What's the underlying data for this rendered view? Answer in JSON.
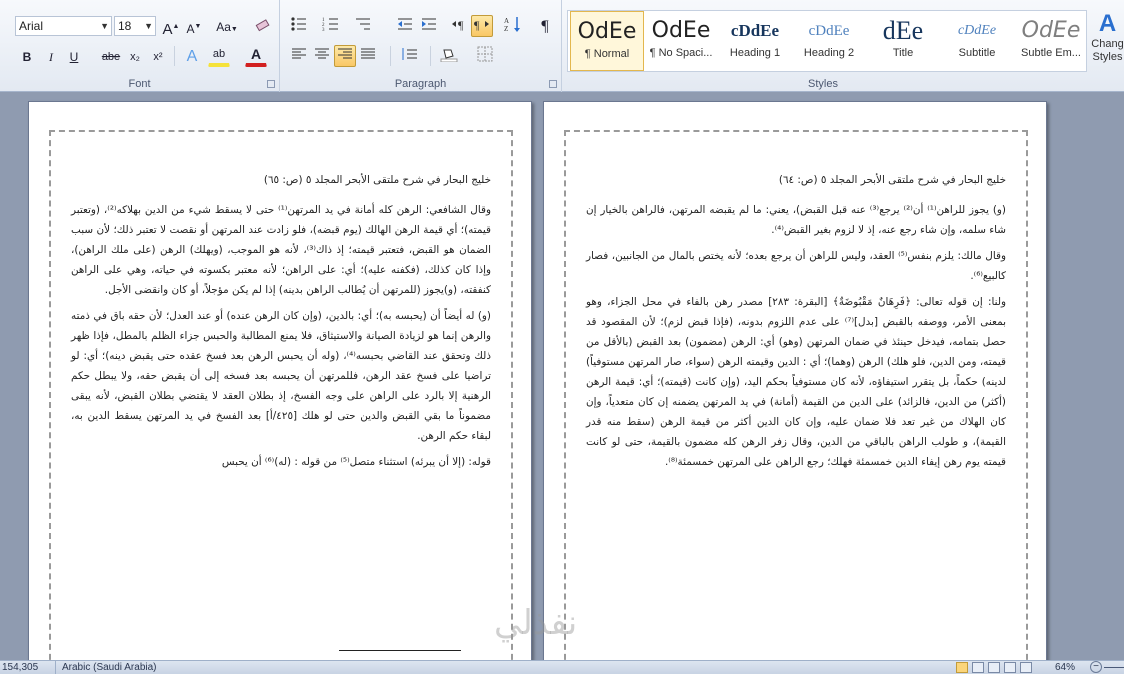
{
  "ribbon": {
    "font": {
      "group_label": "Font",
      "font_name": "Arial",
      "font_size": "18",
      "grow": "A",
      "shrink": "A",
      "change_case": "Aa",
      "bold": "B",
      "italic": "I",
      "underline": "U",
      "strike": "abe",
      "subscript": "x₂",
      "superscript": "x²",
      "text_effects": "A",
      "highlight": "ab",
      "font_color": "A"
    },
    "paragraph": {
      "group_label": "Paragraph"
    },
    "styles": {
      "group_label": "Styles",
      "items": [
        {
          "sample": "OdEe",
          "name": "¶ Normal"
        },
        {
          "sample": "OdEe",
          "name": "¶ No Spaci..."
        },
        {
          "sample": "cDdEe",
          "name": "Heading 1"
        },
        {
          "sample": "cDdEe",
          "name": "Heading 2"
        },
        {
          "sample": "dEe",
          "name": "Title"
        },
        {
          "sample": "cDdEe",
          "name": "Subtitle"
        },
        {
          "sample": "OdEe",
          "name": "Subtle Em..."
        }
      ],
      "change_styles_line1": "Chang",
      "change_styles_line2": "Styles"
    },
    "colors": {
      "highlight": "#f5e23a",
      "font_color": "#d22020",
      "accent": "#2a6fcf"
    }
  },
  "left_page": {
    "header": "خليج البحار في شرح ملتقى الأبحر المجلد ٥ (ص: ٦٥)",
    "paragraphs": [
      "وقال الشافعي: الرهن كله أمانة في يد المرتهن⁽¹⁾ حتى لا يسقط شيء من الدين بهلاكه⁽²⁾، (وتعتبر قيمته)؛ أي قيمة الرهن الهالك (يوم قبضه)، فلو زادت عند المرتهن أو نقصت لا تعتبر ذلك؛ لأن سبب الضمان هو القبض، فتعتبر قيمته؛ إذ ذاك⁽³⁾، لأنه هو الموجب، (ويهلك) الرهن (على ملك الراهن)، وإذا كان كذلك، (فكفنه عليه)؛ أي: على الراهن؛ لأنه معتبر بكسوته في حياته، وهي على الراهن كنفقته، (و)يجوز (للمرتهن أن يُطالب الراهن بدينه) إذا لم يكن مؤجلاً، أو كان وانقضى الأجل.",
      "(و) له أيضاً أن (يحبسه به)؛ أي: بالدين، (وإن كان الرهن عنده) أو عند العدل؛ لأن حقه باق في ذمته والرهن إنما هو لزيادة الصيانة والاستيثاق، فلا يمنع المطالبة والحبس جزاء الظلم بالمطل، فإذا ظهر ذلك وتحقق عند القاضي بحبسه⁽⁴⁾، (وله أن يحبس الرهن بعد فسخ عقده حتى يقبض دينه)؛ أي: لو تراضيا على فسخ عقد الرهن، فللمرتهن أن يحبسه بعد فسخه إلى أن يقبض حقه، ولا يبطل حكم الرهنية إلا بالرد على الراهن على وجه الفسخ، إذ بطلان العقد لا يقتضي بطلان القبض، لأنه يبقى مضموناً ما بقي القبض والدين حتى لو هلك [٤٢٥/أ] بعد الفسخ في يد المرتهن يسقط الدين به، لبقاء حكم الرهن.",
      "قوله: (إلا أن يبرئه) استثناء متصل⁽⁵⁾ من قوله : (له)⁽⁶⁾ أن يحبس"
    ]
  },
  "right_page": {
    "header": "خليج البحار في شرح ملتقى الأبحر المجلد ٥ (ص: ٦٤)",
    "paragraphs": [
      "(و) يجوز للراهن⁽¹⁾ أن⁽²⁾ يرجع⁽³⁾ عنه قبل القبض)، يعني: ما لم يقبضه المرتهن، فالراهن بالخيار إن شاء سلمه، وإن شاء رجع عنه، إذ لا لزوم بغير القبض⁽⁴⁾.",
      "وقال مالك: يلزم بنفس⁽⁵⁾ العقد، وليس للراهن أن يرجع بعده؛ لأنه يختص بالمال من الجانبين، فصار كالبيع⁽⁶⁾.",
      "ولنا: إن قوله تعالى: ﴿فَرِهَانٌ مَقْبُوضَةٌ﴾ [البقرة: ٢٨٣] مصدر رهن بالفاء في محل الجزاء، وهو بمعنى الأمر، ووصفه بالقبض [بدل]⁽⁷⁾ على عدم اللزوم بدونه، (فإذا قبض لزم)؛ لأن المقصود قد حصل بتمامه، فيدخل حينئذ في ضمان المرتهن (وهو) أي: الرهن (مضمون) بعد القبض (بالأقل من قيمته، ومن الدين، فلو هلك) الرهن (وهما)؛ أي : الدين وقيمته الرهن (سواء، صار المرتهن مستوفياً) لدينه) حكماً، بل يتقرر استيفاؤه، لأنه كان مستوفياً بحكم اليد، (وإن كانت (قيمته)؛ أي: قيمة الرهن (أكثر) من الدين، فالزائد) على الدين من القيمة (أمانة) في يد المرتهن يضمنه إن كان متعدياً، وإن كان الهلاك من غير تعد فلا ضمان عليه، وإن كان الدين أكثر من قيمة الرهن (سقط منه قدر القيمة)، و طولب الراهن بالباقي من الدين، وقال زفر الرهن كله مضمون بالقيمة، حتى لو كانت قيمته يوم رهن إيفاء الدين خمسمئة فهلك؛ رجع الراهن على المرتهن خمسمئة⁽⁸⁾."
    ]
  },
  "watermark": "نفذلي",
  "status": {
    "words": "154,305",
    "language": "Arabic (Saudi Arabia)",
    "zoom": "64%"
  }
}
